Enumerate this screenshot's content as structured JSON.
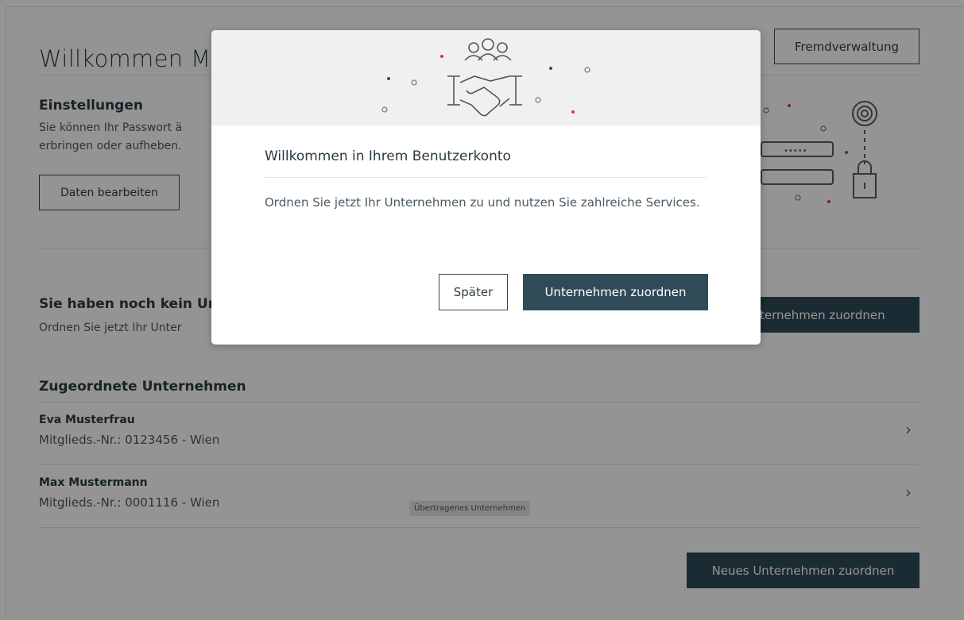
{
  "page": {
    "title": "Willkommen Ma",
    "admin_button": "Fremdverwaltung",
    "settings": {
      "heading": "Einstellungen",
      "text_line1": "Sie können Ihr Passwort ä",
      "text_line2": "erbringen oder aufheben.",
      "edit_button": "Daten bearbeiten"
    },
    "no_company": {
      "heading": "Sie haben noch kein Ur",
      "text": "Ordnen Sie jetzt Ihr Unter",
      "assign_button": "ternehmen zuordnen"
    },
    "assigned": {
      "heading": "Zugeordnete Unternehmen",
      "rows": [
        {
          "name": "Eva Musterfrau",
          "sub": "Mitglieds.-Nr.: 0123456 - Wien",
          "badge": ""
        },
        {
          "name": "Max Mustermann",
          "sub": "Mitglieds.-Nr.: 0001116 - Wien",
          "badge": "Übertragenes Unternehmen"
        }
      ]
    },
    "new_button": "Neues Unternehmen zuordnen"
  },
  "modal": {
    "title": "Willkommen in Ihrem Benutzerkonto",
    "text": "Ordnen Sie jetzt Ihr Unternehmen zu und nutzen Sie zahlreiche Services.",
    "later_button": "Später",
    "assign_button": "Unternehmen zuordnen"
  },
  "icons": {
    "header_illustration": "handshake-icon",
    "settings_illustration": "password-lock-icon",
    "row_chevron": "chevron-right-icon"
  },
  "colors": {
    "accent_dark": "#2f4b58",
    "accent_red": "#e2323b"
  }
}
